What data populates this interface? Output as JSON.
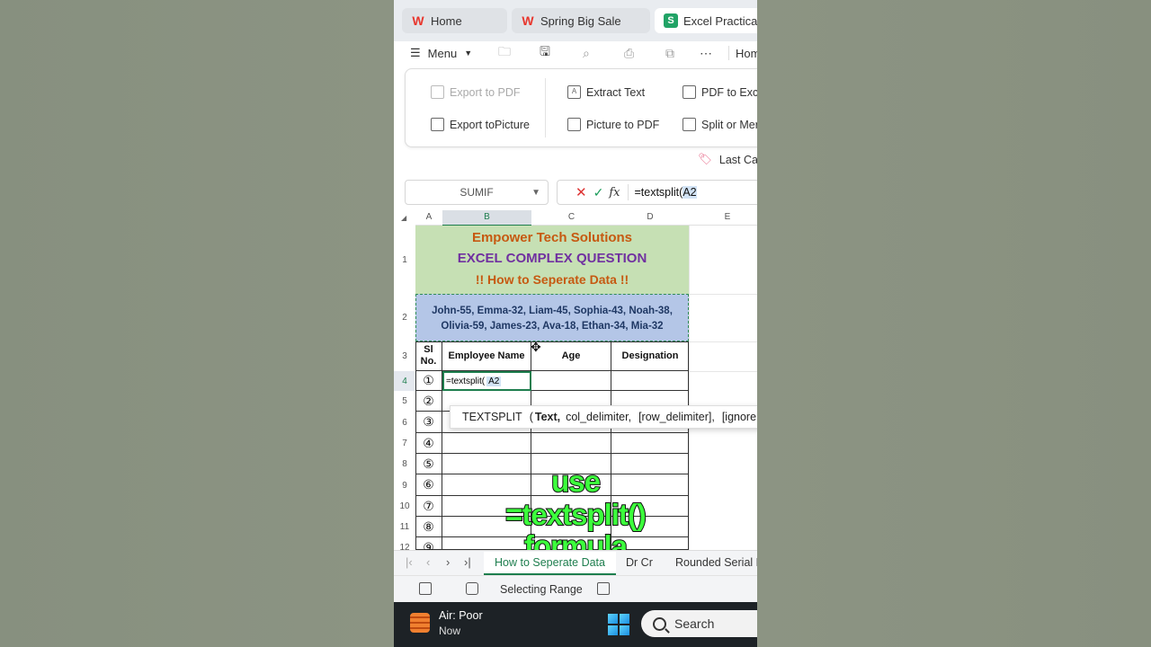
{
  "tabs": [
    {
      "label": "Home",
      "icon": "wps-logo-icon"
    },
    {
      "label": "Spring Big Sale",
      "icon": "wps-logo-icon"
    },
    {
      "label": "Excel Practicals.x",
      "icon": "spreadsheet-icon"
    }
  ],
  "toolbar": {
    "menu_label": "Menu",
    "home_label": "Hom"
  },
  "ribbon": {
    "export_pdf": "Export to PDF",
    "export_picture": "Export toPicture",
    "extract_text": "Extract Text",
    "picture_to_pdf": "Picture to PDF",
    "pdf_to_excel": "PDF to Excel",
    "split_merge": "Split or Merg"
  },
  "promo": "Last Call",
  "formula_bar": {
    "name_box": "SUMIF",
    "formula_prefix": "=textsplit(",
    "formula_ref": "A2"
  },
  "columns": [
    "A",
    "B",
    "C",
    "D",
    "E"
  ],
  "rows": [
    "1",
    "2",
    "3",
    "4",
    "5",
    "6",
    "7",
    "8",
    "9",
    "10",
    "11",
    "12"
  ],
  "sheet": {
    "title1": "Empower Tech Solutions",
    "title2": "EXCEL COMPLEX QUESTION",
    "title3": "!! How to Seperate Data !!",
    "data_line1": "John-55, Emma-32, Liam-45, Sophia-43, Noah-38,",
    "data_line2": "Olivia-59, James-23, Ava-18, Ethan-34, Mia-32",
    "headers": {
      "sl": "Sl No.",
      "name": "Employee Name",
      "age": "Age",
      "designation": "Designation"
    },
    "serials": [
      "①",
      "②",
      "③",
      "④",
      "⑤",
      "⑥",
      "⑦",
      "⑧",
      "⑨"
    ],
    "edit_prefix": "=textsplit(",
    "edit_ref": "A2"
  },
  "tooltip": {
    "fn": "TEXTSPLIT",
    "open": "(",
    "arg1": "Text,",
    "arg2": "col_delimiter,",
    "arg3": "[row_delimiter],",
    "arg4": "[ignore"
  },
  "overlay": {
    "line1": "use",
    "line2": "=textsplit()",
    "line3": "formula"
  },
  "sheet_tabs": [
    "How to Seperate Data",
    "Dr Cr",
    "Rounded Serial N"
  ],
  "status": {
    "mode": "Selecting Range"
  },
  "taskbar": {
    "weather": "Air: Poor",
    "weather_sub": "Now",
    "search": "Search"
  }
}
